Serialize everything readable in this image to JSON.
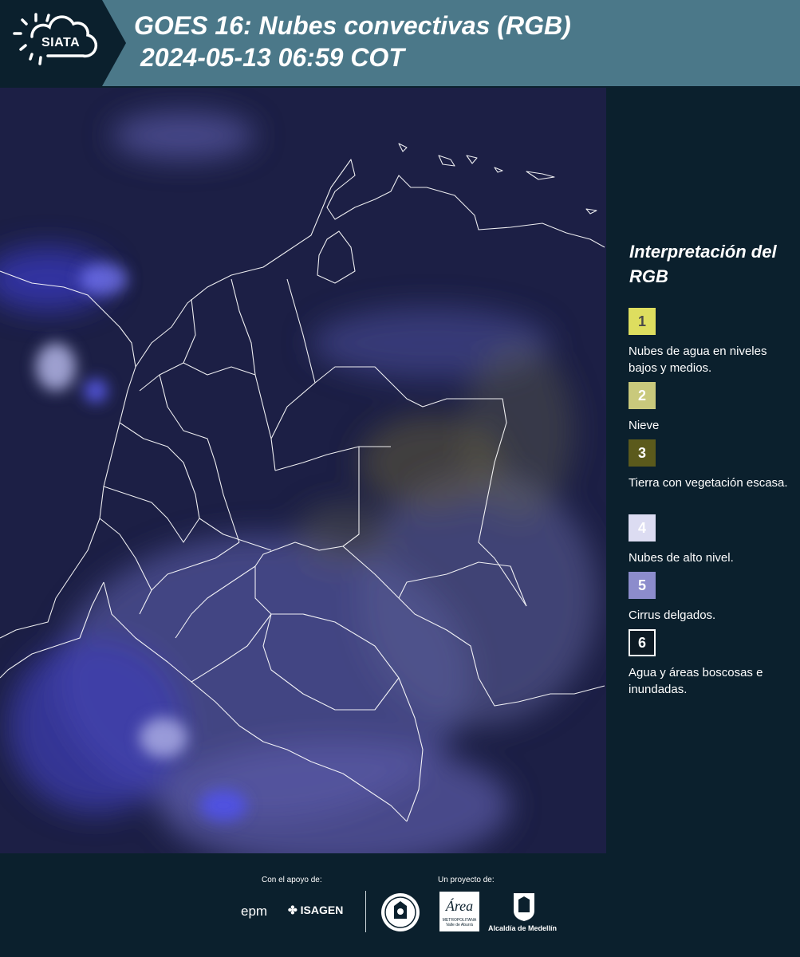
{
  "header": {
    "logo_text": "SIATA",
    "title_line1": "GOES 16: Nubes convectivas (RGB)",
    "title_line2": "2024-05-13 06:59 COT"
  },
  "legend": {
    "title": "Interpretación del RGB",
    "items": [
      {
        "number": "1",
        "label": "Nubes de agua en niveles bajos y medios.",
        "color": "#dede5f"
      },
      {
        "number": "2",
        "label": "Nieve",
        "color": "#c9c97c"
      },
      {
        "number": "3",
        "label": "Tierra con vegetación escasa.",
        "color": "#5b5a1c"
      },
      {
        "number": "4",
        "label": "Nubes de alto nivel.",
        "color": "#dcdcf2"
      },
      {
        "number": "5",
        "label": "Cirrus delgados.",
        "color": "#8c8ccc"
      },
      {
        "number": "6",
        "label": "Agua y áreas boscosas e inundadas.",
        "color": "#0d1a24"
      }
    ]
  },
  "footer": {
    "support_label": "Con el apoyo de:",
    "project_label": "Un proyecto de:",
    "sponsors": [
      "epm",
      "ISAGEN"
    ],
    "partners": [
      "Área Metropolitana Valle de Aburrá",
      "Alcaldía de Medellín"
    ],
    "partner_texts": {
      "area_name": "Área",
      "area_sub1": "METROPOLITANA",
      "area_sub2": "Valle de Aburrá",
      "alcaldia": "Alcaldía de Medellín"
    }
  }
}
